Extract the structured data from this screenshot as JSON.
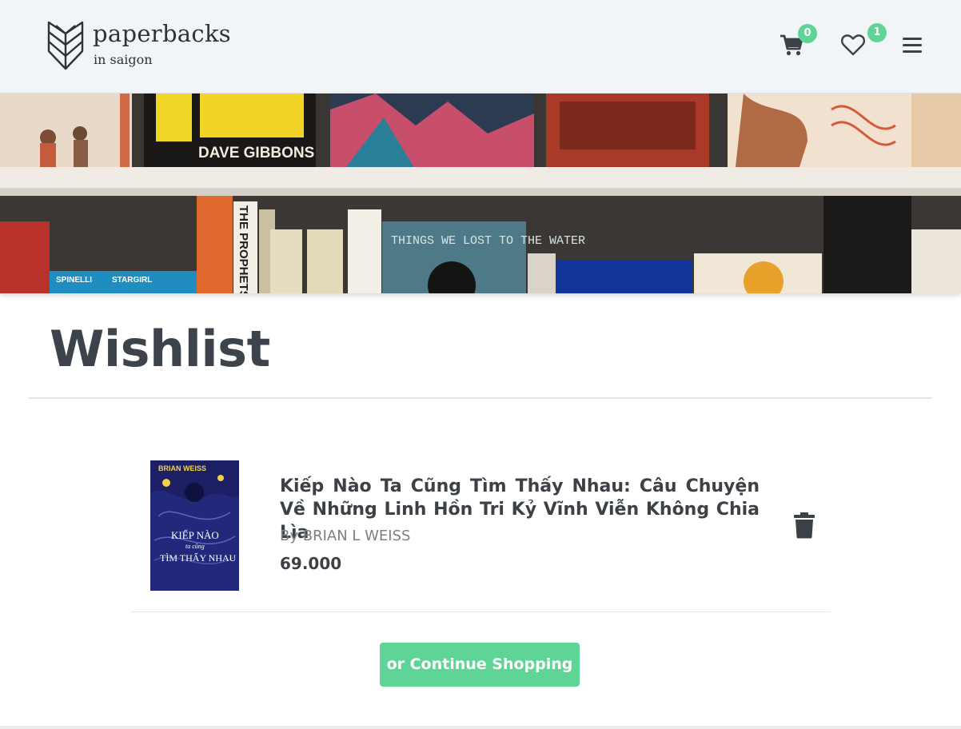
{
  "header": {
    "logo_title": "paperbacks",
    "logo_subtitle": "in saigon",
    "logo_icon": "book-leaf-icon",
    "cart_icon": "cart-icon",
    "cart_count": "0",
    "wishlist_icon": "heart-icon",
    "wishlist_count": "1",
    "menu_icon": "hamburger-menu-icon"
  },
  "banner": {
    "book_titles": [
      "DAVE GIBBONS",
      "THE PROPHETS",
      "THINGS WE LOST TO THE WATER",
      "STARGIRL",
      "SPINELLI"
    ]
  },
  "main": {
    "title": "Wishlist",
    "items": [
      {
        "title": "Kiếp Nào Ta Cũng Tìm Thấy Nhau: Câu Chuyện Về Những Linh Hồn Tri Kỷ Vĩnh Viễn Không Chia Lìa",
        "author": "By BRIAN L WEISS",
        "price": "69.000",
        "cover_author": "BRIAN WEISS",
        "cover_title_line1": "KIẾP NÀO",
        "cover_title_line2": "ta cũng",
        "cover_title_line3": "TÌM THẤY NHAU",
        "delete_icon": "trash-icon"
      }
    ],
    "continue_label": "or Continue Shopping"
  },
  "colors": {
    "accent": "#5ed497",
    "header_bg": "#f2f5f7",
    "text": "#3c4148"
  }
}
